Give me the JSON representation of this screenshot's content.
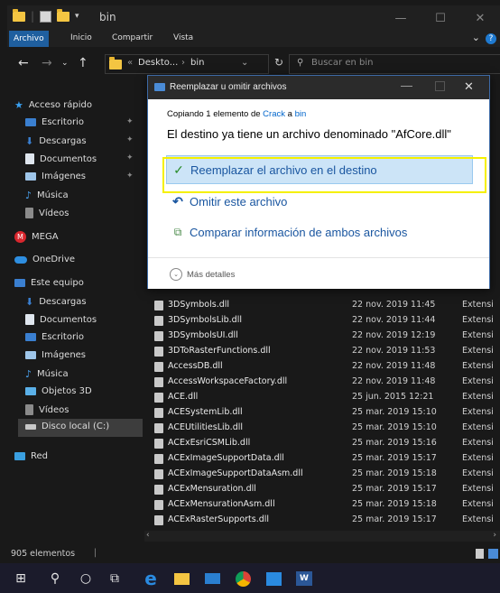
{
  "window": {
    "title": "bin",
    "buttons": {
      "minimize": "—",
      "maximize": "☐",
      "close": "✕"
    }
  },
  "ribbon": {
    "tabs": [
      "Archivo",
      "Inicio",
      "Compartir",
      "Vista"
    ]
  },
  "address": {
    "prefix": "«",
    "crumbs": [
      "Deskto...",
      "bin"
    ],
    "search_placeholder": "Buscar en bin"
  },
  "sidebar": {
    "quick_access": "Acceso rápido",
    "quick_items": [
      {
        "label": "Escritorio",
        "icon": "desktop-icon",
        "pinned": true
      },
      {
        "label": "Descargas",
        "icon": "download-icon",
        "pinned": true
      },
      {
        "label": "Documentos",
        "icon": "documents-icon",
        "pinned": true
      },
      {
        "label": "Imágenes",
        "icon": "pictures-icon",
        "pinned": true
      },
      {
        "label": "Música",
        "icon": "music-icon",
        "pinned": false
      },
      {
        "label": "Vídeos",
        "icon": "videos-icon",
        "pinned": false
      }
    ],
    "mega": "MEGA",
    "onedrive": "OneDrive",
    "this_pc": "Este equipo",
    "pc_items": [
      {
        "label": "Descargas",
        "icon": "download-icon"
      },
      {
        "label": "Documentos",
        "icon": "documents-icon"
      },
      {
        "label": "Escritorio",
        "icon": "desktop-icon"
      },
      {
        "label": "Imágenes",
        "icon": "pictures-icon"
      },
      {
        "label": "Música",
        "icon": "music-icon"
      },
      {
        "label": "Objetos 3D",
        "icon": "3d-objects-icon"
      },
      {
        "label": "Vídeos",
        "icon": "videos-icon"
      },
      {
        "label": "Disco local (C:)",
        "icon": "drive-icon"
      }
    ],
    "network": "Red"
  },
  "files": [
    {
      "name": "3DSymbols.dll",
      "date": "22 nov. 2019 11:45",
      "type": "Extensi"
    },
    {
      "name": "3DSymbolsLib.dll",
      "date": "22 nov. 2019 11:44",
      "type": "Extensi"
    },
    {
      "name": "3DSymbolsUI.dll",
      "date": "22 nov. 2019 12:19",
      "type": "Extensi"
    },
    {
      "name": "3DToRasterFunctions.dll",
      "date": "22 nov. 2019 11:53",
      "type": "Extensi"
    },
    {
      "name": "AccessDB.dll",
      "date": "22 nov. 2019 11:48",
      "type": "Extensi"
    },
    {
      "name": "AccessWorkspaceFactory.dll",
      "date": "22 nov. 2019 11:48",
      "type": "Extensi"
    },
    {
      "name": "ACE.dll",
      "date": "25 jun. 2015 12:21",
      "type": "Extensi"
    },
    {
      "name": "ACESystemLib.dll",
      "date": "25 mar. 2019 15:10",
      "type": "Extensi"
    },
    {
      "name": "ACEUtilitiesLib.dll",
      "date": "25 mar. 2019 15:10",
      "type": "Extensi"
    },
    {
      "name": "ACExEsriCSMLib.dll",
      "date": "25 mar. 2019 15:16",
      "type": "Extensi"
    },
    {
      "name": "ACExImageSupportData.dll",
      "date": "25 mar. 2019 15:17",
      "type": "Extensi"
    },
    {
      "name": "ACExImageSupportDataAsm.dll",
      "date": "25 mar. 2019 15:18",
      "type": "Extensi"
    },
    {
      "name": "ACExMensuration.dll",
      "date": "25 mar. 2019 15:17",
      "type": "Extensi"
    },
    {
      "name": "ACExMensurationAsm.dll",
      "date": "25 mar. 2019 15:18",
      "type": "Extensi"
    },
    {
      "name": "ACExRasterSupports.dll",
      "date": "25 mar. 2019 15:17",
      "type": "Extensi"
    }
  ],
  "status": {
    "count": "905 elementos"
  },
  "dialog": {
    "title": "Reemplazar u omitir archivos",
    "copy_prefix": "Copiando 1 elemento de",
    "copy_from": "Crack",
    "copy_mid": "a",
    "copy_to": "bin",
    "message": "El destino ya tiene un archivo denominado \"AfCore.dll\"",
    "option_replace": "Reemplazar el archivo en el destino",
    "option_skip": "Omitir este archivo",
    "option_compare": "Comparar información de ambos archivos",
    "more_details": "Más detalles"
  },
  "colors": {
    "accent": "#1f5f9f",
    "link": "#0066cc",
    "option_text": "#1a56a0",
    "highlight_border": "#f5f000",
    "check": "#2a8c2a"
  }
}
